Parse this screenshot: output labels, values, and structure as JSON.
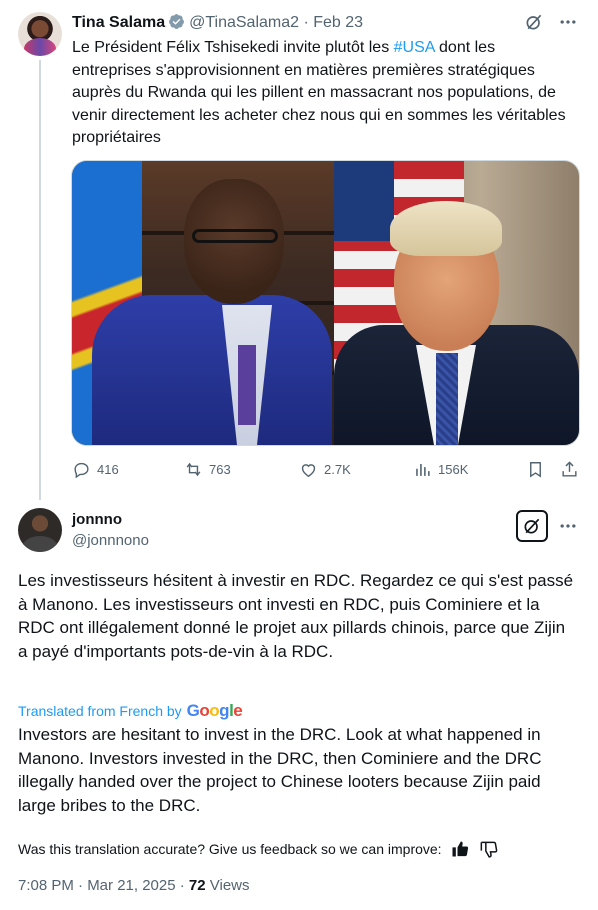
{
  "parent_tweet": {
    "name": "Tina Salama",
    "handle": "@TinaSalama2",
    "date": "· Feb 23",
    "text_before": "Le Président Félix Tshisekedi invite plutôt les ",
    "hashtag": "#USA",
    "text_after": " dont les entreprises s'approvisionnent en matières premières stratégiques auprès du Rwanda qui les pillent en massacrant nos populations, de venir directement les acheter chez nous qui en sommes les véritables propriétaires",
    "stats": {
      "replies": "416",
      "reposts": "763",
      "likes": "2.7K",
      "views": "156K"
    }
  },
  "main_tweet": {
    "name": "jonnno",
    "handle": "@jonnnono",
    "text": "Les investisseurs hésitent à investir en RDC. Regardez ce qui s'est passé à Manono. Les investisseurs ont investi en RDC, puis Cominiere et la RDC ont illégalement donné le projet aux pillards chinois, parce que Zijin a payé d'importants pots-de-vin à la RDC.",
    "translated_label": "Translated from French by",
    "translated_provider": "Google",
    "translation": "Investors are hesitant to invest in the DRC. Look at what happened in Manono. Investors invested in the DRC, then Cominiere and the DRC illegally handed over the project to Chinese looters because Zijin paid large bribes to the DRC.",
    "feedback_prompt": "Was this translation accurate? Give us feedback so we can improve:",
    "time": "7:08 PM · Mar 21, 2025 · ",
    "views_count": "72",
    "views_label": " Views"
  },
  "icons": [
    "verified-icon",
    "grok-icon",
    "more-icon",
    "reply-icon",
    "repost-icon",
    "like-icon",
    "views-icon",
    "bookmark-icon",
    "share-icon",
    "thumbs-up-icon",
    "thumbs-down-icon"
  ],
  "colors": {
    "accent": "#1d9bf0",
    "text": "#0f1419",
    "secondary": "#536471"
  }
}
